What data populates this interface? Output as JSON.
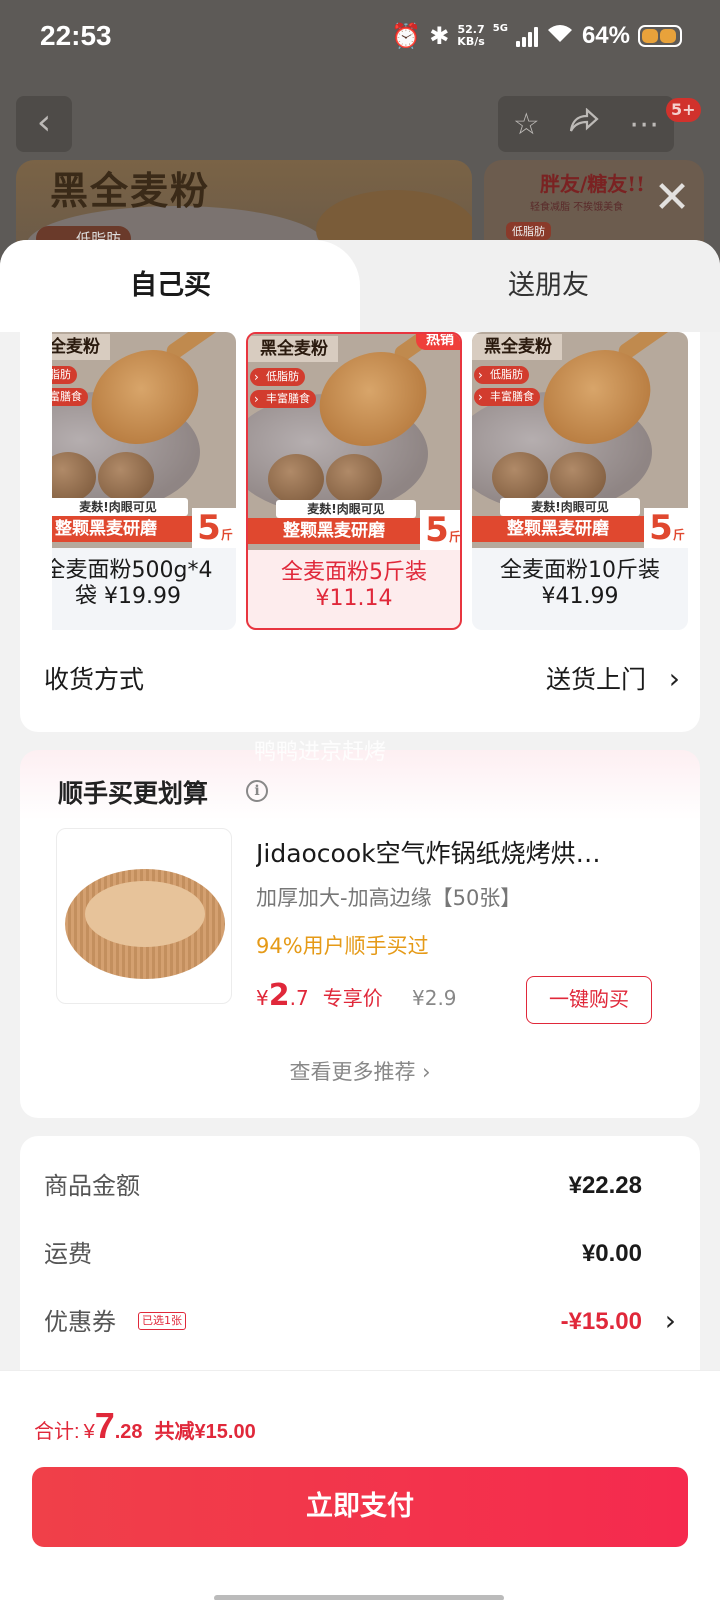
{
  "status_bar": {
    "time": "22:53",
    "net_speed_top": "52.7",
    "net_speed_bottom": "KB/s",
    "network": "5G",
    "battery": "64%"
  },
  "background": {
    "card1_title": "黑全麦粉",
    "card1_badge": "低脂肪",
    "card2_title": "胖友/糖友!!",
    "card2_sub": "轻食减脂 不挨饿美食",
    "card2_badge": "低脂肪",
    "nav_badge": "5+"
  },
  "tabs": {
    "own": "自己买",
    "gift": "送朋友"
  },
  "skus": [
    {
      "name": "全麦面粉500g*4袋 ¥19.99",
      "line1": "全麦面粉500g*4",
      "line2": "袋 ¥19.99",
      "selected": false,
      "hot": ""
    },
    {
      "name": "全麦面粉5斤装 ¥11.14",
      "line1": "全麦面粉5斤装",
      "line2": "¥11.14",
      "selected": true,
      "hot": "热销"
    },
    {
      "name": "全麦面粉10斤装 ¥41.99",
      "line1": "全麦面粉10斤装",
      "line2": "¥41.99",
      "selected": false,
      "hot": ""
    }
  ],
  "sku_image": {
    "title": "黑全麦粉",
    "tag1": "低脂肪",
    "tag2": "丰富膳食",
    "banner_white": "麦麸!肉眼可见",
    "banner_red": "整颗黑麦研磨",
    "big_num": "5",
    "big_unit": "斤"
  },
  "delivery": {
    "label": "收货方式",
    "value": "送货上门"
  },
  "watermark": "鸭鸭进京赶烤",
  "addon": {
    "title": "顺手买更划算",
    "product_name": "Jidaocook空气炸锅纸烧烤烘…",
    "spec": "加厚加大-加高边缘【50张】",
    "stat": "94%用户顺手买过",
    "price_currency": "¥",
    "price_int": "2",
    "price_dec": ".7",
    "price_label": "专享价",
    "original_price": "¥2.9",
    "buy_button": "一键购买",
    "more": "查看更多推荐 ›"
  },
  "summary": {
    "goods_label": "商品金额",
    "goods_value": "¥22.28",
    "shipping_label": "运费",
    "shipping_value": "¥0.00",
    "coupon_label": "优惠券",
    "coupon_tag": "已选1张",
    "coupon_value": "-¥15.00"
  },
  "footer": {
    "total_label": "合计:",
    "total_currency": "¥",
    "total_int": "7",
    "total_dec": ".28",
    "total_saved": "共减¥15.00",
    "pay_button": "立即支付"
  },
  "colors": {
    "accent": "#e0283a",
    "pay_button": "#f52a4e",
    "stat": "#e59a17"
  }
}
